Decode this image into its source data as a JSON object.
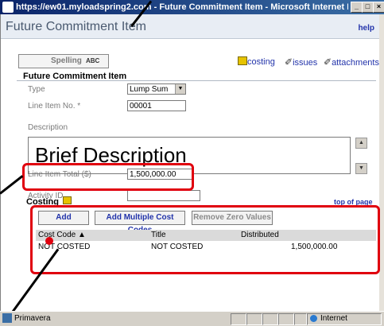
{
  "window": {
    "title": "https://ew01.myloadspring2.com - Future Commitment Item - Microsoft Internet Explorer provided ..."
  },
  "page": {
    "title": "Future Commitment Item",
    "help": "help"
  },
  "toolbar": {
    "spelling": "Spelling",
    "spelling_icon": "ABC",
    "costing": "costing",
    "issues": "issues",
    "attachments": "attachments"
  },
  "section": {
    "title": "Future Commitment Item"
  },
  "form": {
    "type_label": "Type",
    "type_value": "Lump Sum",
    "line_item_label": "Line Item No. *",
    "line_item_value": "00001",
    "description_label": "Description",
    "description_value": "Brief Description",
    "total_label": "Line Item Total ($)",
    "total_value": "1,500,000.00",
    "activity_label": "Activity ID",
    "activity_value": ""
  },
  "costing": {
    "title": "Costing",
    "top_link": "top of page",
    "add": "Add",
    "add_multiple": "Add Multiple Cost Codes",
    "remove_zero": "Remove Zero Values",
    "columns": [
      "Cost Code ▲",
      "Title",
      "Distributed"
    ],
    "rows": [
      [
        "NOT COSTED",
        "NOT COSTED",
        "1,500,000.00"
      ]
    ]
  },
  "statusbar": {
    "left": "Primavera",
    "zone": "Internet"
  },
  "colors": {
    "highlight": "#e0000e",
    "link": "#2233aa"
  }
}
